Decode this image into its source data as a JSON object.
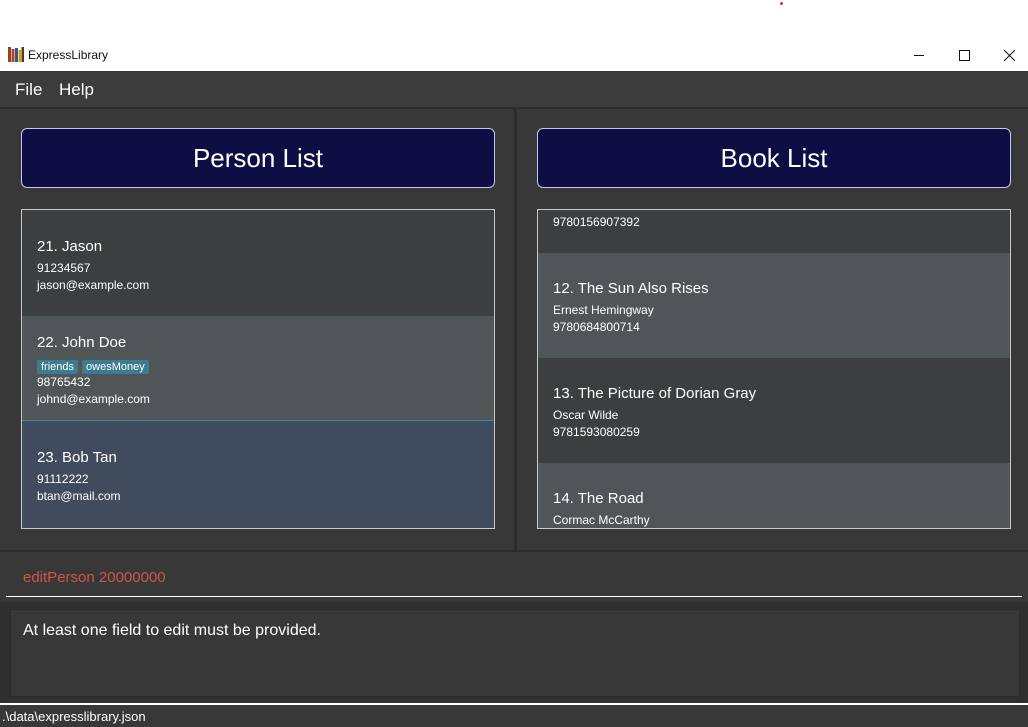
{
  "window": {
    "title": "ExpressLibrary"
  },
  "menu": {
    "file": "File",
    "help": "Help"
  },
  "person_panel": {
    "header": "Person List",
    "items": [
      {
        "title": "21.  Jason",
        "phone": "91234567",
        "email": "jason@example.com",
        "tags": []
      },
      {
        "title": "22.  John Doe",
        "tags": [
          "friends",
          "owesMoney"
        ],
        "phone": "98765432",
        "email": "johnd@example.com"
      },
      {
        "title": "23.  Bob Tan",
        "phone": "91112222",
        "email": "btan@mail.com",
        "tags": [],
        "selected": true
      }
    ]
  },
  "book_panel": {
    "header": "Book List",
    "items": [
      {
        "partial_line": "9780156907392"
      },
      {
        "title": "12.  The Sun Also Rises",
        "author": "Ernest Hemingway",
        "isbn": "9780684800714"
      },
      {
        "title": "13.  The Picture of Dorian Gray",
        "author": "Oscar Wilde",
        "isbn": "9781593080259"
      },
      {
        "title": "14.  The Road",
        "author": "Cormac McCarthy"
      }
    ]
  },
  "command": {
    "value": "editPerson 20000000"
  },
  "result": {
    "message": "At least one field to edit must be provided."
  },
  "status": {
    "path": ".\\data\\expresslibrary.json"
  },
  "colors": {
    "header_bg": "#0e0e45",
    "error_text": "#d1534a",
    "tag_bg": "#3e7b91",
    "selected_card": "#404b5e"
  }
}
